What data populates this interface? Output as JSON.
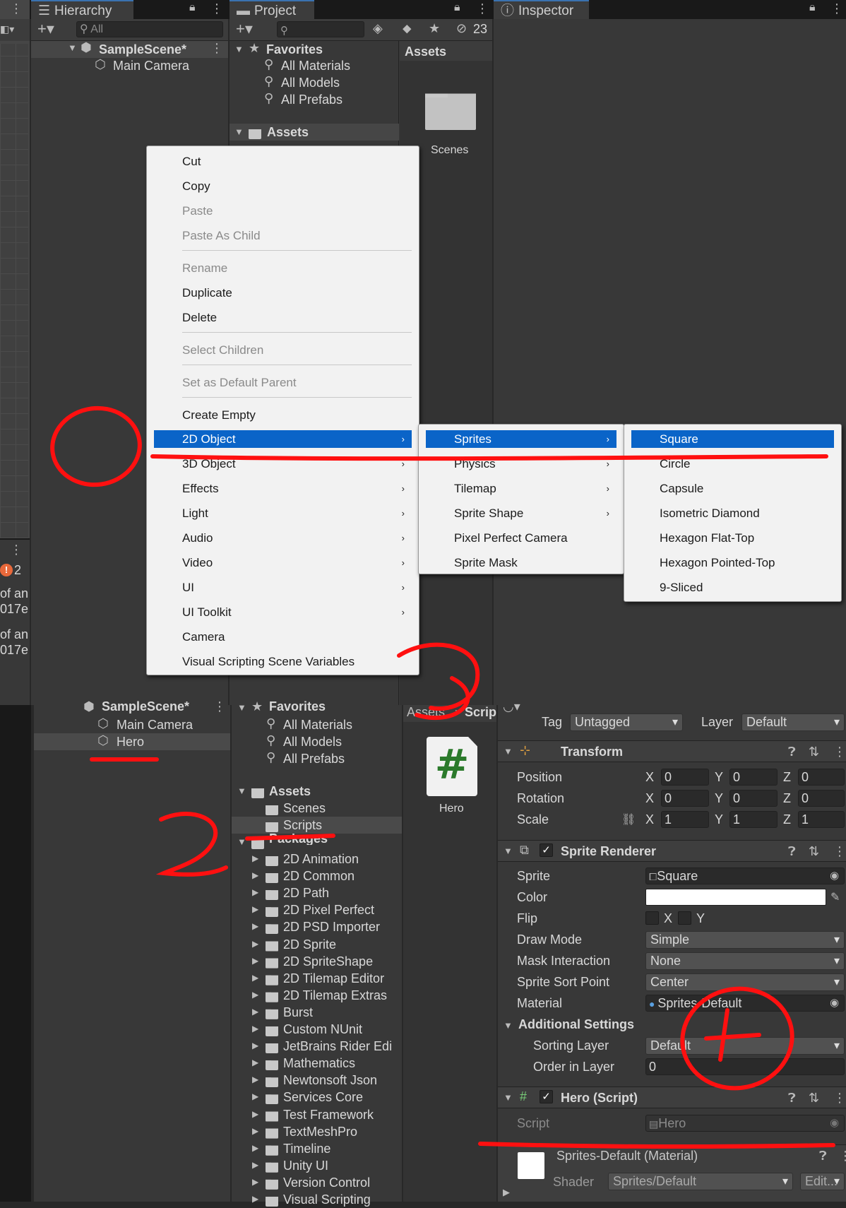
{
  "top": {
    "hierarchy_tab": "Hierarchy",
    "project_tab": "Project",
    "inspector_tab": "Inspector",
    "search_placeholder": "All",
    "hidden_count": "23",
    "scene_name": "SampleScene*",
    "main_camera": "Main Camera",
    "favorites": "Favorites",
    "fav_items": [
      "All Materials",
      "All Models",
      "All Prefabs"
    ],
    "assets_folder": "Assets",
    "assets_header": "Assets",
    "scenes_label": "Scenes"
  },
  "console": {
    "warning_count": "2",
    "line1a": "of an",
    "line1b": "017e",
    "line2a": "of an",
    "line2b": "017e"
  },
  "context_menu": {
    "items": [
      "Cut",
      "Copy",
      "Paste",
      "Paste As Child",
      "Rename",
      "Duplicate",
      "Delete",
      "Select Children",
      "Set as Default Parent",
      "Create Empty",
      "2D Object",
      "3D Object",
      "Effects",
      "Light",
      "Audio",
      "Video",
      "UI",
      "UI Toolkit",
      "Camera",
      "Visual Scripting Scene Variables"
    ]
  },
  "submenu_2d": {
    "items": [
      "Sprites",
      "Physics",
      "Tilemap",
      "Sprite Shape",
      "Pixel Perfect Camera",
      "Sprite Mask"
    ]
  },
  "submenu_sprites": {
    "items": [
      "Square",
      "Circle",
      "Capsule",
      "Isometric Diamond",
      "Hexagon Flat-Top",
      "Hexagon Pointed-Top",
      "9-Sliced"
    ]
  },
  "bottom_hierarchy": {
    "scene_name": "SampleScene*",
    "main_camera": "Main Camera",
    "hero": "Hero"
  },
  "bottom_project": {
    "favorites": "Favorites",
    "fav_items": [
      "All Materials",
      "All Models",
      "All Prefabs"
    ],
    "assets": "Assets",
    "asset_folders": [
      "Scenes",
      "Scripts"
    ],
    "packages": "Packages",
    "package_folders": [
      "2D Animation",
      "2D Common",
      "2D Path",
      "2D Pixel Perfect",
      "2D PSD Importer",
      "2D Sprite",
      "2D SpriteShape",
      "2D Tilemap Editor",
      "2D Tilemap Extras",
      "Burst",
      "Custom NUnit",
      "JetBrains Rider Edi",
      "Mathematics",
      "Newtonsoft Json",
      "Services Core",
      "Test Framework",
      "TextMeshPro",
      "Timeline",
      "Unity UI",
      "Version Control",
      "Visual Scripting"
    ],
    "breadcrumb_assets": "Assets",
    "breadcrumb_scripts": "Scrip",
    "hero_file": "Hero",
    "hash_glyph": "#"
  },
  "inspector": {
    "tag_label": "Tag",
    "tag_value": "Untagged",
    "layer_label": "Layer",
    "layer_value": "Default",
    "transform_title": "Transform",
    "position_label": "Position",
    "rotation_label": "Rotation",
    "scale_label": "Scale",
    "axis_x": "X",
    "axis_y": "Y",
    "axis_z": "Z",
    "position": [
      "0",
      "0",
      "0"
    ],
    "rotation": [
      "0",
      "0",
      "0"
    ],
    "scale": [
      "1",
      "1",
      "1"
    ],
    "sprite_renderer_title": "Sprite Renderer",
    "sprite_label": "Sprite",
    "sprite_value": "Square",
    "color_label": "Color",
    "color_value": "#ffffff",
    "flip_label": "Flip",
    "draw_mode_label": "Draw Mode",
    "draw_mode_value": "Simple",
    "mask_interaction_label": "Mask Interaction",
    "mask_interaction_value": "None",
    "sort_point_label": "Sprite Sort Point",
    "sort_point_value": "Center",
    "material_label": "Material",
    "material_value": "Sprites-Default",
    "additional_settings": "Additional Settings",
    "sorting_layer_label": "Sorting Layer",
    "sorting_layer_value": "Default",
    "order_label": "Order in Layer",
    "order_value": "0",
    "hero_script_title": "Hero (Script)",
    "script_label": "Script",
    "script_value": "Hero",
    "material_asset_title": "Sprites-Default (Material)",
    "shader_label": "Shader",
    "shader_value": "Sprites/Default",
    "edit_button": "Edit..."
  },
  "annotations": [
    "①",
    "②",
    "③",
    "④"
  ],
  "colors": {
    "menu_highlight": "#0a64c8",
    "annotation_red": "#ff1010"
  }
}
